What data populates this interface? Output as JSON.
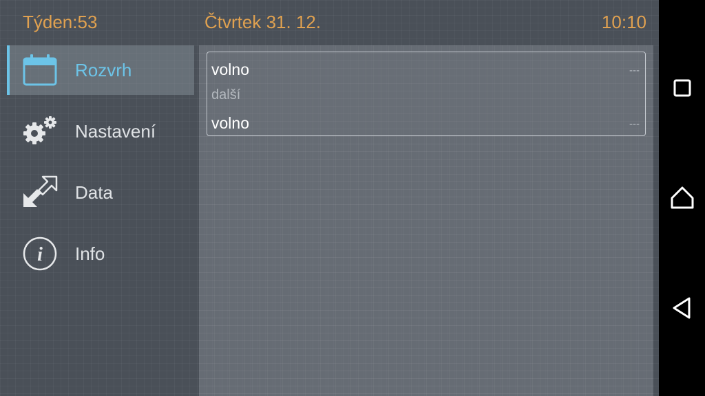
{
  "header": {
    "week": "Týden:53",
    "date": "Čtvrtek  31. 12.",
    "time": "10:10"
  },
  "sidebar": {
    "items": [
      {
        "label": "Rozvrh",
        "icon": "calendar-icon",
        "active": true
      },
      {
        "label": "Nastavení",
        "icon": "gears-icon",
        "active": false
      },
      {
        "label": "Data",
        "icon": "transfer-arrows-icon",
        "active": false
      },
      {
        "label": "Info",
        "icon": "info-icon",
        "active": false
      }
    ]
  },
  "schedule": {
    "current": {
      "subject": "volno",
      "room": "---"
    },
    "next_label": "další",
    "next": {
      "subject": "volno",
      "room": "---"
    }
  },
  "system_nav": {
    "buttons": [
      "recent-apps-icon",
      "home-icon",
      "back-icon"
    ]
  },
  "colors": {
    "accent": "#6cc4e8",
    "header_text": "#e0a150",
    "background": "#4a5058"
  }
}
